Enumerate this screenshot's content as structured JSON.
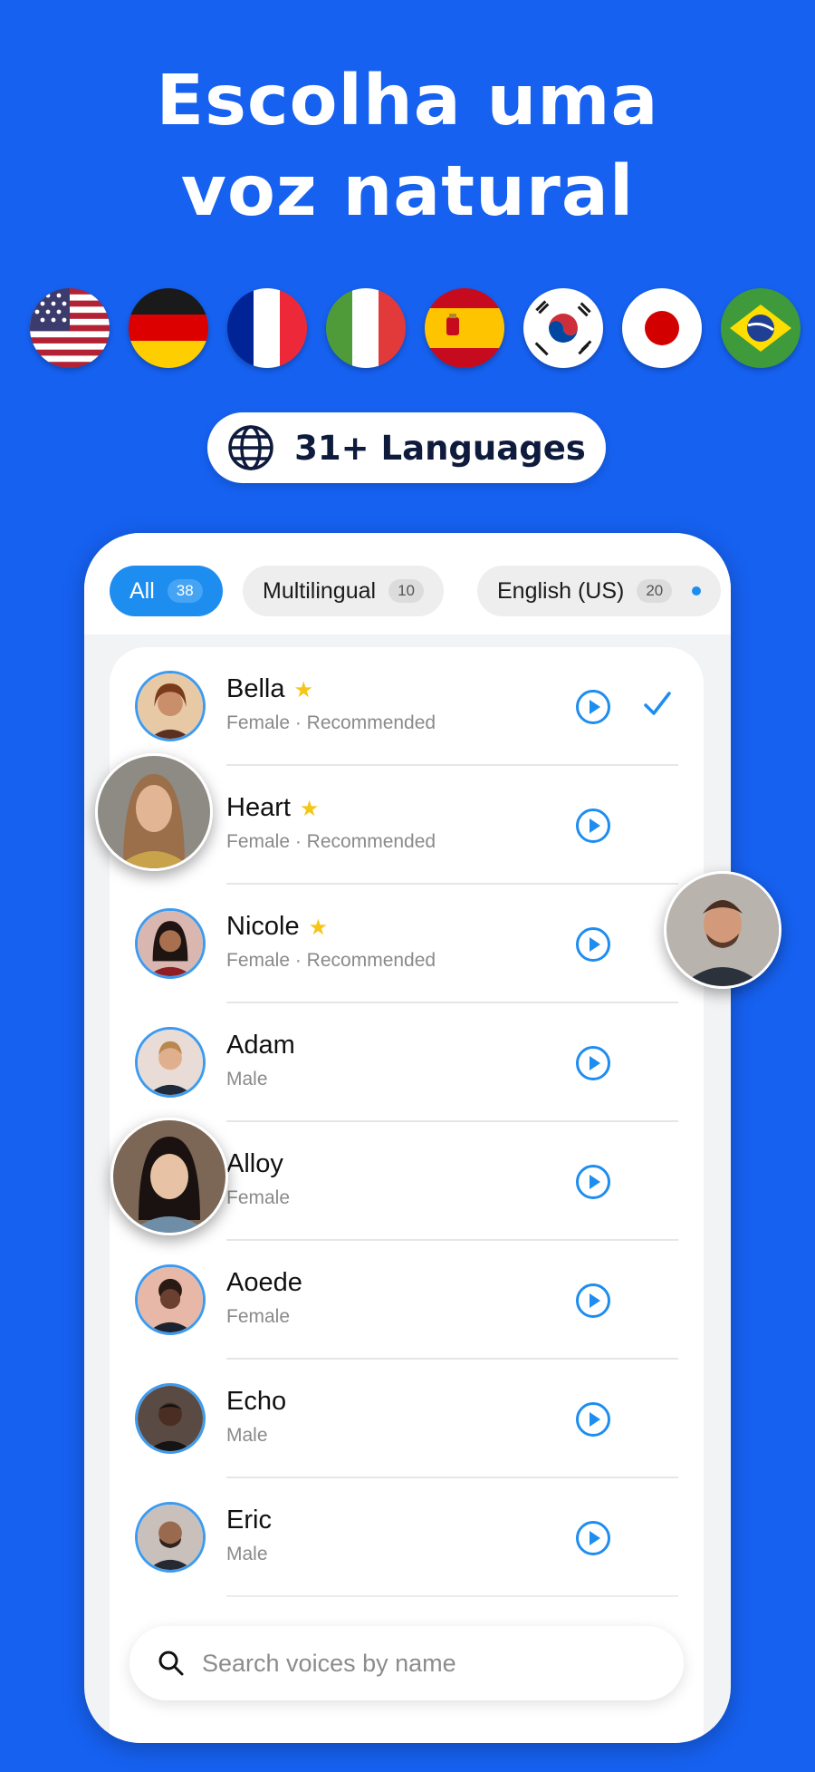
{
  "headline": {
    "line1": "Escolha uma",
    "line2": "voz natural"
  },
  "flags": [
    "flag-us",
    "flag-de",
    "flag-fr",
    "flag-it",
    "flag-es",
    "flag-kr",
    "flag-jp",
    "flag-br"
  ],
  "languages_badge": {
    "icon": "globe-icon",
    "label": "31+ Languages"
  },
  "tabs": [
    {
      "label": "All",
      "count": "38",
      "active": true
    },
    {
      "label": "Multilingual",
      "count": "10",
      "active": false
    },
    {
      "label": "English (US)",
      "count": "20",
      "active": false
    }
  ],
  "voices": [
    {
      "name": "Bella",
      "subtitle": "Female · Recommended",
      "starred": true,
      "selected": true
    },
    {
      "name": "Heart",
      "subtitle": "Female · Recommended",
      "starred": true,
      "selected": false
    },
    {
      "name": "Nicole",
      "subtitle": "Female · Recommended",
      "starred": true,
      "selected": false
    },
    {
      "name": "Adam",
      "subtitle": "Male",
      "starred": false,
      "selected": false
    },
    {
      "name": "Alloy",
      "subtitle": "Female",
      "starred": false,
      "selected": false
    },
    {
      "name": "Aoede",
      "subtitle": "Female",
      "starred": false,
      "selected": false
    },
    {
      "name": "Echo",
      "subtitle": "Male",
      "starred": false,
      "selected": false
    },
    {
      "name": "Eric",
      "subtitle": "Male",
      "starred": false,
      "selected": false
    }
  ],
  "search": {
    "placeholder": "Search voices by name",
    "icon": "search-icon"
  },
  "colors": {
    "background": "#1661F0",
    "accent": "#1E8DF0",
    "star": "#F5C518"
  }
}
